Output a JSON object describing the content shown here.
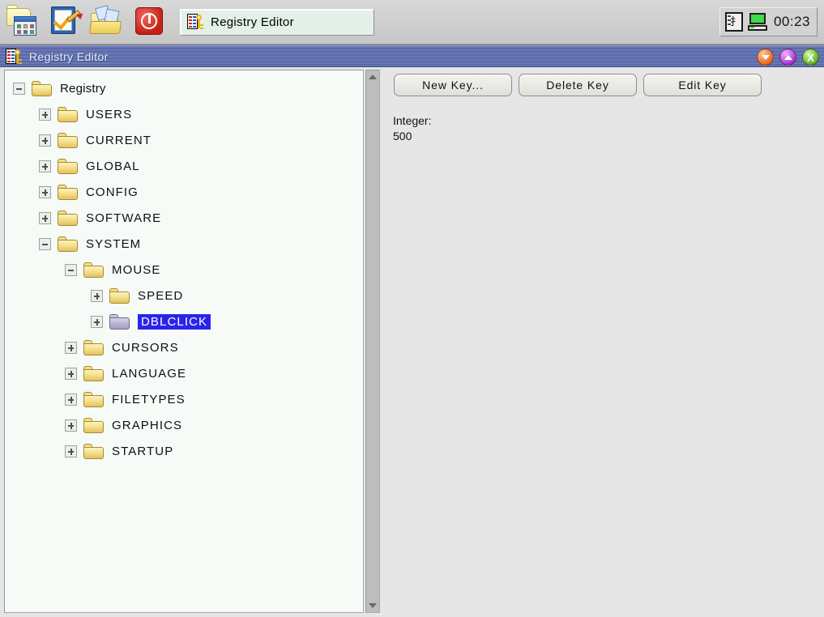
{
  "taskbar": {
    "launchers": [
      {
        "name": "folder-apps-icon",
        "title": "Programs"
      },
      {
        "name": "notepad-check-icon",
        "title": "Editor"
      },
      {
        "name": "open-folder-icon",
        "title": "Files"
      },
      {
        "name": "power-icon",
        "title": "Shutdown"
      }
    ],
    "task_entry": {
      "label": "Registry  Editor",
      "icon": "registry-icon"
    },
    "tray": {
      "keyboard_icon": "input-method-icon",
      "keyboard_glyph": "扌",
      "monitor_icon": "display-icon",
      "clock": "00:23"
    }
  },
  "window": {
    "title": "Registry  Editor",
    "icon": "registry-icon",
    "buttons": {
      "minimize": {
        "name": "minimize-button",
        "label": ""
      },
      "maximize": {
        "name": "maximize-button",
        "label": ""
      },
      "close": {
        "name": "close-button",
        "label": "X"
      }
    }
  },
  "tree": {
    "nodes": [
      {
        "label": "Registry",
        "indent": 1,
        "expander": "minus",
        "folder": "open",
        "selected": false,
        "mixed": true
      },
      {
        "label": "USERS",
        "indent": 2,
        "expander": "plus",
        "folder": "closed",
        "selected": false
      },
      {
        "label": "CURRENT",
        "indent": 2,
        "expander": "plus",
        "folder": "closed",
        "selected": false
      },
      {
        "label": "GLOBAL",
        "indent": 2,
        "expander": "plus",
        "folder": "closed",
        "selected": false
      },
      {
        "label": "CONFIG",
        "indent": 2,
        "expander": "plus",
        "folder": "closed",
        "selected": false
      },
      {
        "label": "SOFTWARE",
        "indent": 2,
        "expander": "plus",
        "folder": "closed",
        "selected": false
      },
      {
        "label": "SYSTEM",
        "indent": 2,
        "expander": "minus",
        "folder": "closed",
        "selected": false
      },
      {
        "label": "MOUSE",
        "indent": 3,
        "expander": "minus",
        "folder": "closed",
        "selected": false
      },
      {
        "label": "SPEED",
        "indent": 4,
        "expander": "plus",
        "folder": "closed",
        "selected": false
      },
      {
        "label": "DBLCLICK",
        "indent": 4,
        "expander": "plus",
        "folder": "selected",
        "selected": true
      },
      {
        "label": "CURSORS",
        "indent": 3,
        "expander": "plus",
        "folder": "closed",
        "selected": false
      },
      {
        "label": "LANGUAGE",
        "indent": 3,
        "expander": "plus",
        "folder": "closed",
        "selected": false
      },
      {
        "label": "FILETYPES",
        "indent": 3,
        "expander": "plus",
        "folder": "closed",
        "selected": false
      },
      {
        "label": "GRAPHICS",
        "indent": 3,
        "expander": "plus",
        "folder": "closed",
        "selected": false
      },
      {
        "label": "STARTUP",
        "indent": 3,
        "expander": "plus",
        "folder": "closed",
        "selected": false
      }
    ]
  },
  "toolbar": {
    "new_key_label": "New  Key...",
    "delete_key_label": "Delete  Key",
    "edit_key_label": "Edit  Key"
  },
  "value": {
    "type_label": "Integer:",
    "value_text": "500"
  },
  "colors": {
    "titlebar": "#5b6aa8",
    "selection": "#2b24e8",
    "tree_bg": "#f6fbf7",
    "panel_bg": "#e6e6e6",
    "taskbar_bg": "#cfcfcf",
    "folder": "#f6e08f"
  }
}
